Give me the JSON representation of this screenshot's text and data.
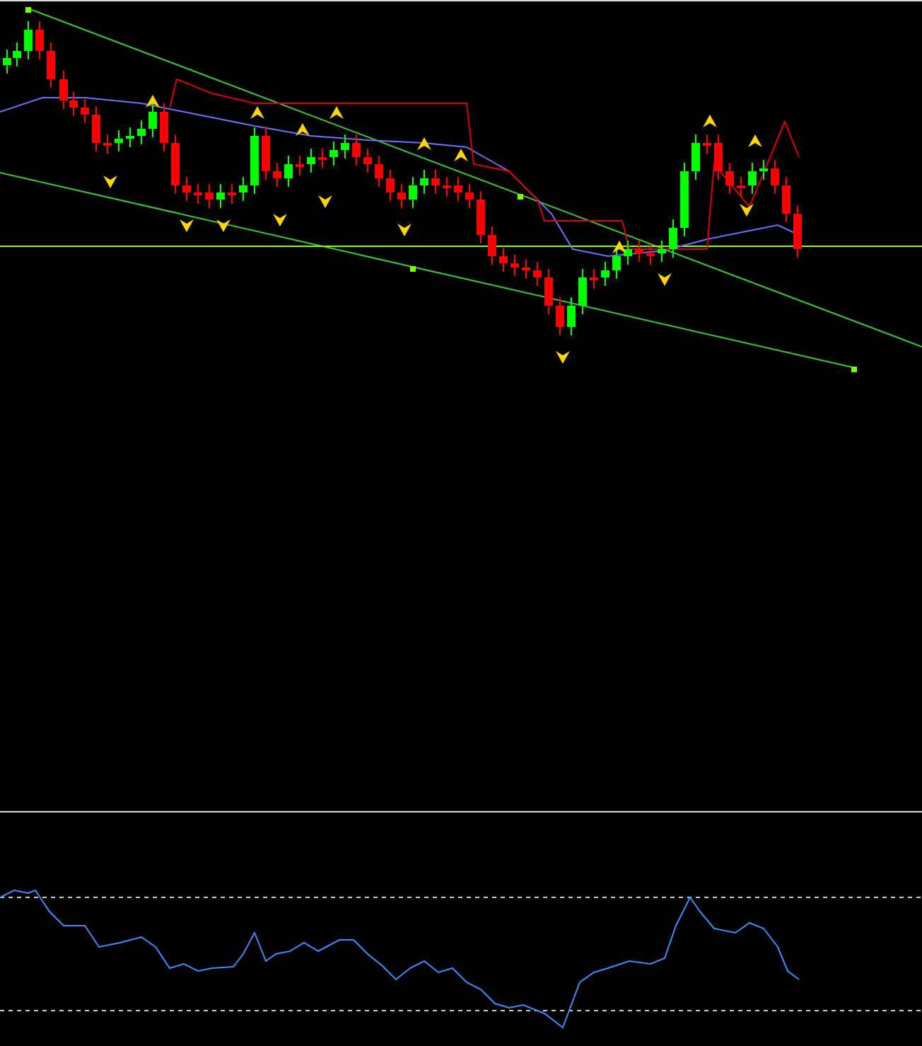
{
  "panels": [
    {
      "kind": "price"
    },
    {
      "kind": "oscillator"
    }
  ]
}
